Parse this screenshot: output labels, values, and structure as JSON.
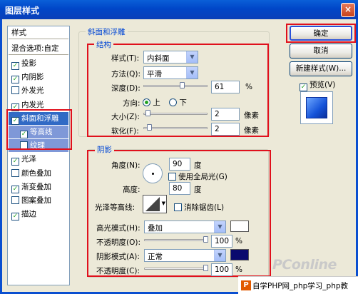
{
  "window": {
    "title": "图层样式",
    "close": "×"
  },
  "sidebar": {
    "header": "样式",
    "blend_options": "混合选项:自定",
    "items": [
      {
        "label": "投影",
        "checked": true
      },
      {
        "label": "内阴影",
        "checked": true
      },
      {
        "label": "外发光",
        "checked": false
      },
      {
        "label": "内发光",
        "checked": true
      },
      {
        "label": "斜面和浮雕",
        "checked": true,
        "selected": true
      },
      {
        "label": "等高线",
        "checked": true,
        "sub": true
      },
      {
        "label": "纹理",
        "checked": false,
        "sub": true
      },
      {
        "label": "光泽",
        "checked": true
      },
      {
        "label": "颜色叠加",
        "checked": false
      },
      {
        "label": "渐变叠加",
        "checked": true
      },
      {
        "label": "图案叠加",
        "checked": false
      },
      {
        "label": "描边",
        "checked": true
      }
    ]
  },
  "bevel": {
    "group_title": "斜面和浮雕",
    "structure_title": "结构",
    "style_label": "样式(T):",
    "style_value": "内斜面",
    "method_label": "方法(Q):",
    "method_value": "平滑",
    "depth_label": "深度(D):",
    "depth_value": "61",
    "depth_unit": "%",
    "depth_fraction": 0.61,
    "direction_label": "方向:",
    "dir_up": "上",
    "dir_down": "下",
    "size_label": "大小(Z):",
    "size_value": "2",
    "size_unit": "像素",
    "size_fraction": 0.02,
    "soften_label": "软化(F):",
    "soften_value": "2",
    "soften_unit": "像素",
    "soften_fraction": 0.05
  },
  "shading": {
    "title": "阴影",
    "angle_label": "角度(N):",
    "angle_value": "90",
    "angle_unit": "度",
    "global_light": "使用全局光(G)",
    "altitude_label": "高度:",
    "altitude_value": "80",
    "altitude_unit": "度",
    "gloss_label": "光泽等高线:",
    "antialias": "消除锯齿(L)",
    "highlight_mode_label": "高光模式(H):",
    "highlight_mode_value": "叠加",
    "highlight_color": "#ffffff",
    "highlight_opacity_label": "不透明度(O):",
    "highlight_opacity_value": "100",
    "highlight_opacity_unit": "%",
    "shadow_mode_label": "阴影模式(A):",
    "shadow_mode_value": "正常",
    "shadow_color": "#0a0a6e",
    "shadow_opacity_label": "不透明度(C):",
    "shadow_opacity_value": "100",
    "shadow_opacity_unit": "%"
  },
  "buttons": {
    "ok": "确定",
    "cancel": "取消",
    "new_style": "新建样式(W)...",
    "preview": "预览(V)"
  },
  "footer": {
    "text": "自学PHP网_php学习_php教",
    "logo": "P"
  },
  "watermark": "PConline"
}
